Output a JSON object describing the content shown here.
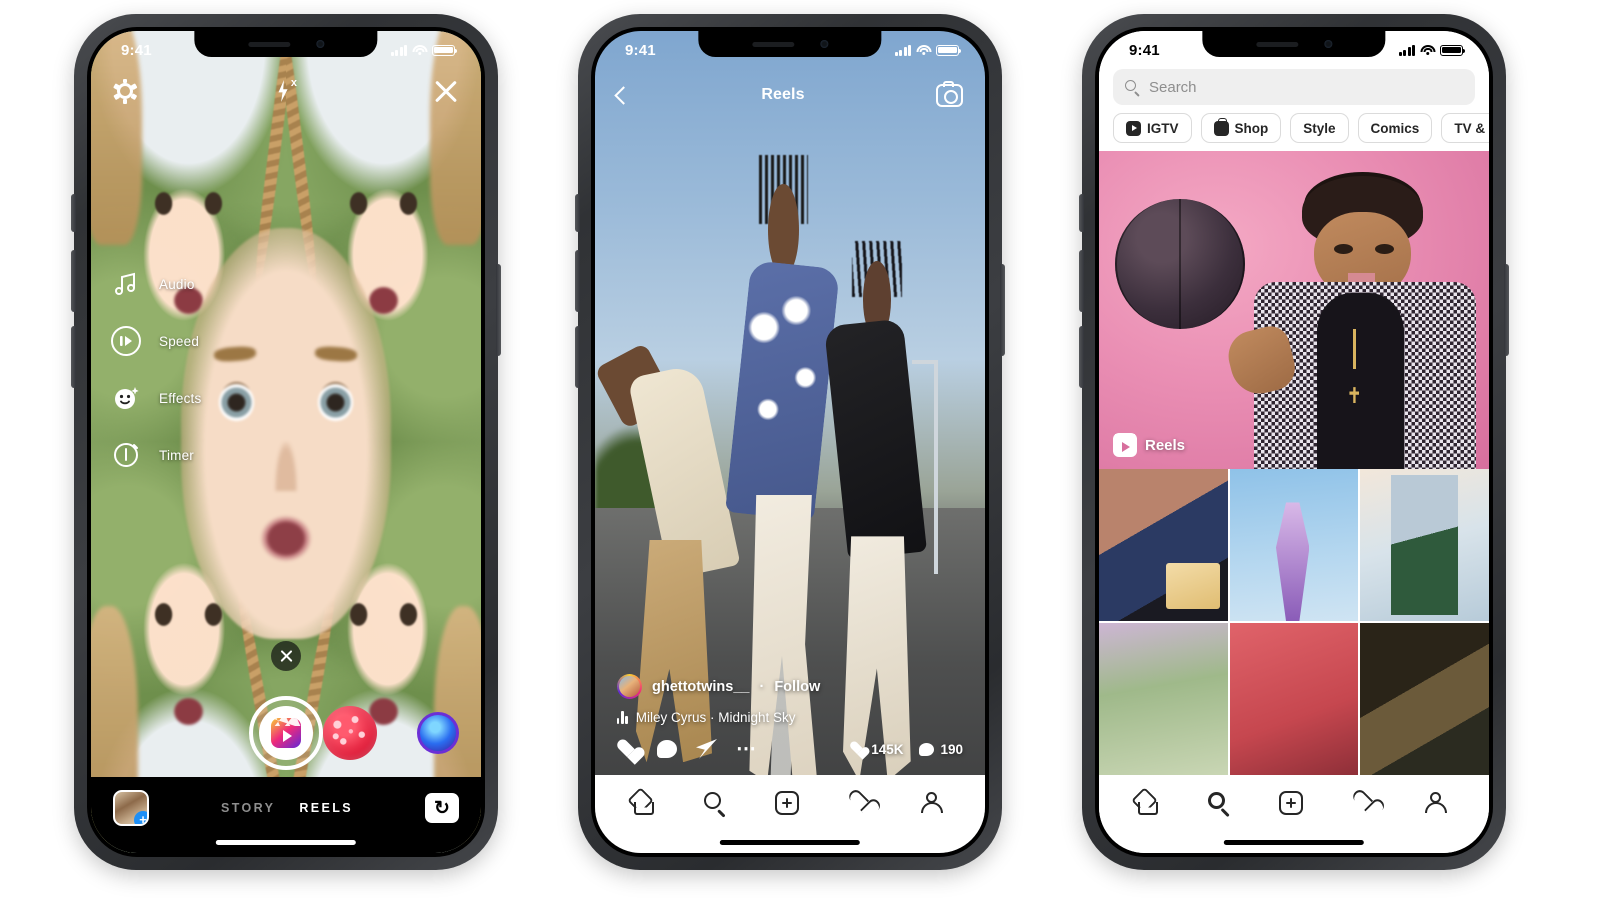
{
  "meta": {
    "background_color": "#ffffff",
    "accent_color": "#ee2a7b"
  },
  "status_bar": {
    "time": "9:41",
    "signal": "cellular-bars-icon",
    "wifi": "wifi-icon",
    "battery": "battery-full-icon"
  },
  "phone1": {
    "screen_name": "Reels camera",
    "top_bar": {
      "settings": "gear-icon",
      "flash": "flash-off-icon",
      "close": "close-icon"
    },
    "tools": [
      {
        "label": "Audio",
        "icon": "music-note-icon"
      },
      {
        "label": "Speed",
        "icon": "speed-icon"
      },
      {
        "label": "Effects",
        "icon": "smiley-sparkle-icon"
      },
      {
        "label": "Timer",
        "icon": "timer-icon"
      }
    ],
    "effects_tray": {
      "close": "close-icon",
      "shutter": "reels-shutter-button",
      "effect_1": "red-hearts-effect",
      "effect_2": "blue-lens-effect"
    },
    "bottom": {
      "gallery": "gallery-thumbnail",
      "gallery_badge": "+",
      "modes": [
        {
          "label": "STORY",
          "active": false
        },
        {
          "label": "REELS",
          "active": true
        }
      ],
      "flip_camera": "flip-camera-icon",
      "flip_glyph": "↻"
    }
  },
  "phone2": {
    "screen_name": "Reels viewer",
    "header": {
      "back": "back-chevron-icon",
      "title": "Reels",
      "camera": "camera-icon"
    },
    "post": {
      "username": "ghettotwins__",
      "separator": "·",
      "follow_label": "Follow",
      "audio_icon": "audio-wave-icon",
      "audio_text": "Miley Cyrus · Midnight Sky",
      "actions": [
        "like-icon",
        "comment-icon",
        "share-icon",
        "more-options-icon"
      ],
      "like_count": "145K",
      "comment_count": "190"
    },
    "tabbar": [
      {
        "name": "home",
        "active": false
      },
      {
        "name": "search",
        "active": false
      },
      {
        "name": "create",
        "active": false
      },
      {
        "name": "activity",
        "active": false
      },
      {
        "name": "profile",
        "active": false
      }
    ]
  },
  "phone3": {
    "screen_name": "Explore",
    "search": {
      "placeholder": "Search",
      "icon": "search-icon",
      "value": ""
    },
    "chips": [
      {
        "label": "IGTV",
        "icon": "igtv-icon"
      },
      {
        "label": "Shop",
        "icon": "shop-bag-icon"
      },
      {
        "label": "Style",
        "icon": ""
      },
      {
        "label": "Comics",
        "icon": ""
      },
      {
        "label": "TV & Movies",
        "icon": ""
      }
    ],
    "hero": {
      "badge_label": "Reels",
      "badge_icon": "reels-icon"
    },
    "tabbar": [
      {
        "name": "home",
        "active": false
      },
      {
        "name": "search",
        "active": true
      },
      {
        "name": "create",
        "active": false
      },
      {
        "name": "activity",
        "active": false
      },
      {
        "name": "profile",
        "active": false
      }
    ]
  }
}
